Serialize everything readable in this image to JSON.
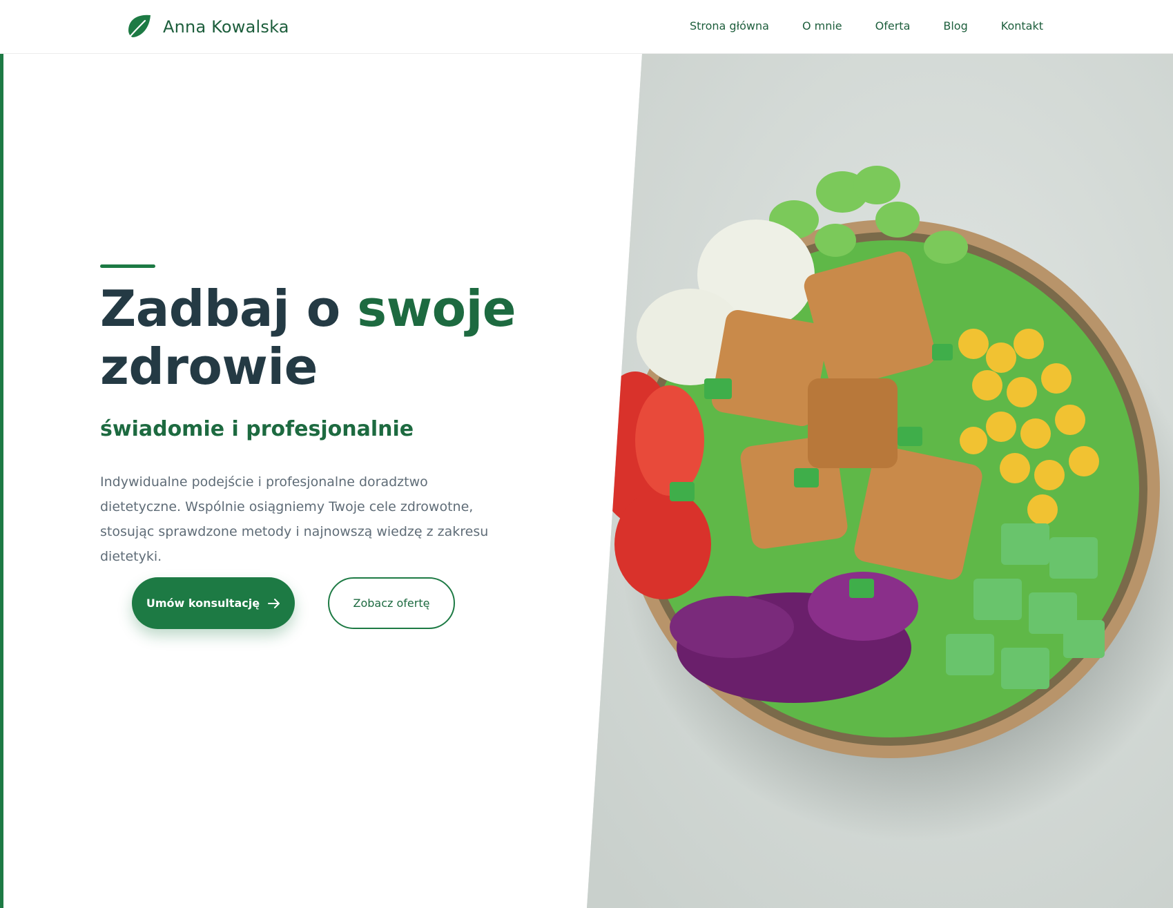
{
  "header": {
    "brand": "Anna Kowalska",
    "logo_icon": "leaf-icon",
    "nav": [
      {
        "label": "Strona główna"
      },
      {
        "label": "O mnie"
      },
      {
        "label": "Oferta"
      },
      {
        "label": "Blog"
      },
      {
        "label": "Kontakt"
      }
    ]
  },
  "hero": {
    "title_part1": "Zadbaj o ",
    "title_accent": "swoje",
    "title_part2": "zdrowie",
    "subtitle": "świadomie i profesjonalnie",
    "description": "Indywidualne podejście i profesjonalne doradztwo dietetyczne. Wspólnie osiągniemy Twoje cele zdrowotne, stosując sprawdzone metody i najnowszą wiedzę z zakresu dietetyki.",
    "primary_button": "Umów konsultację",
    "primary_button_icon": "arrow-right-icon",
    "secondary_button": "Zobacz ofertę",
    "image": "salad-bowl-image"
  },
  "colors": {
    "brand_green": "#1d7a44",
    "dark_text": "#243a44",
    "muted_text": "#5f6c77"
  }
}
